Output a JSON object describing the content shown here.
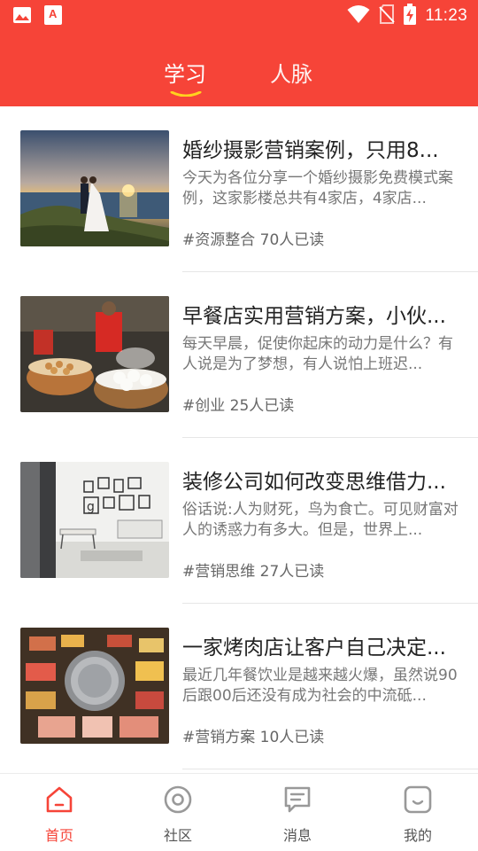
{
  "status_bar": {
    "time": "11:23",
    "icons": [
      "image-icon",
      "app-a-icon",
      "wifi-icon",
      "no-sim-icon",
      "battery-charging-icon"
    ]
  },
  "tabs": [
    {
      "label": "学习",
      "active": true
    },
    {
      "label": "人脉",
      "active": false
    }
  ],
  "articles": [
    {
      "title": "婚纱摄影营销案例，只用8...",
      "summary": "今天为各位分享一个婚纱摄影免费模式案例，这家影楼总共有4家店，4家店...",
      "meta": "#资源整合 70人已读",
      "thumbnail": "wedding-couple-sunset-photo"
    },
    {
      "title": "早餐店实用营销方案，小伙...",
      "summary": "每天早晨，促使你起床的动力是什么？有人说是为了梦想，有人说怕上班迟...",
      "meta": "#创业 25人已读",
      "thumbnail": "breakfast-steamer-buns-photo"
    },
    {
      "title": "装修公司如何改变思维借力...",
      "summary": "俗话说:人为财死，鸟为食亡。可见财富对人的诱惑力有多大。但是，世界上...",
      "meta": "#营销思维 27人已读",
      "thumbnail": "white-interior-room-photo"
    },
    {
      "title": "一家烤肉店让客户自己决定...",
      "summary": "最近几年餐饮业是越来越火爆，虽然说90后跟00后还没有成为社会的中流砥...",
      "meta": "#营销方案 10人已读",
      "thumbnail": "korean-bbq-grill-photo"
    }
  ],
  "bottom_nav": [
    {
      "label": "首页",
      "icon": "home-icon",
      "active": true
    },
    {
      "label": "社区",
      "icon": "community-icon",
      "active": false
    },
    {
      "label": "消息",
      "icon": "message-icon",
      "active": false
    },
    {
      "label": "我的",
      "icon": "profile-icon",
      "active": false
    }
  ],
  "colors": {
    "brand_red": "#f64438",
    "tab_underline": "#ffd21f",
    "title_text": "#222222",
    "summary_text": "#777777"
  }
}
